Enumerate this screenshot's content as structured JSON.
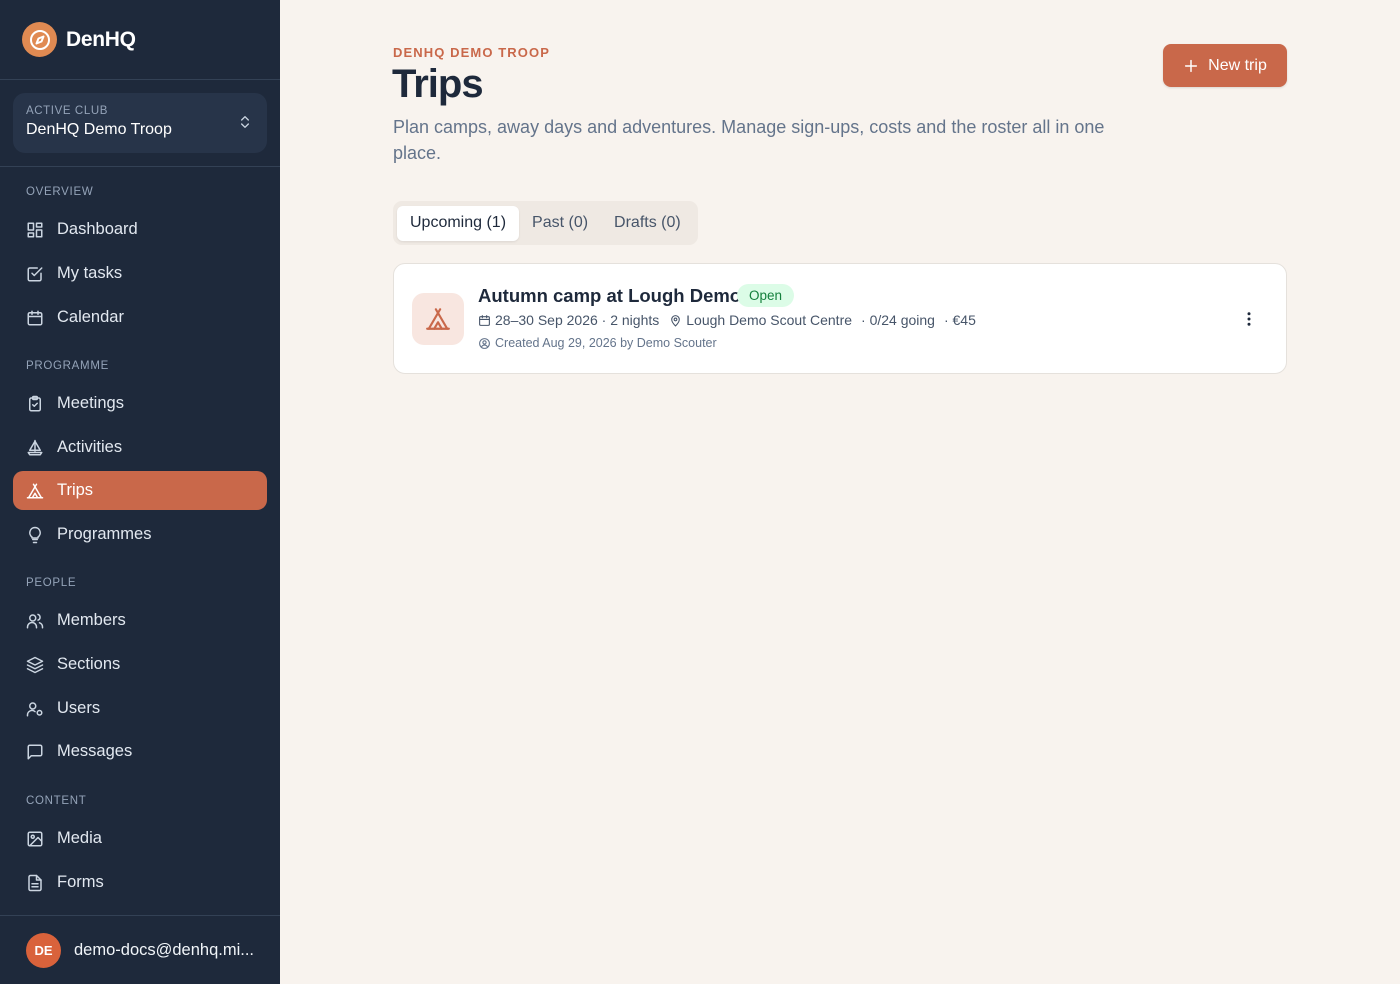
{
  "brand": {
    "name": "DenHQ",
    "accent": "#e08a52"
  },
  "club": {
    "label": "ACTIVE CLUB",
    "name": "DenHQ Demo Troop"
  },
  "nav": {
    "sections": [
      "OVERVIEW",
      "PROGRAMME",
      "PEOPLE",
      "CONTENT"
    ],
    "items": [
      {
        "label": "Dashboard",
        "icon": "dashboard-icon"
      },
      {
        "label": "My tasks",
        "icon": "checkbox-icon"
      },
      {
        "label": "Calendar",
        "icon": "calendar-icon"
      },
      {
        "label": "Meetings",
        "icon": "clipboard-check-icon"
      },
      {
        "label": "Activities",
        "icon": "sailboat-icon"
      },
      {
        "label": "Trips",
        "icon": "tent-icon",
        "active": true
      },
      {
        "label": "Programmes",
        "icon": "lightbulb-icon"
      },
      {
        "label": "Members",
        "icon": "users-icon"
      },
      {
        "label": "Sections",
        "icon": "layers-icon"
      },
      {
        "label": "Users",
        "icon": "user-cog-icon"
      },
      {
        "label": "Messages",
        "icon": "message-icon"
      },
      {
        "label": "Media",
        "icon": "image-icon"
      },
      {
        "label": "Forms",
        "icon": "file-text-icon"
      }
    ]
  },
  "user": {
    "initials": "DE",
    "email": "demo-docs@denhq.mi..."
  },
  "header": {
    "eyebrow": "DENHQ DEMO TROOP",
    "title": "Trips",
    "description": "Plan camps, away days and adventures. Manage sign-ups, costs and the roster all in one place.",
    "new_button": "New trip"
  },
  "tabs": [
    {
      "label": "Upcoming (1)",
      "active": true
    },
    {
      "label": "Past (0)"
    },
    {
      "label": "Drafts (0)"
    }
  ],
  "trips": [
    {
      "title": "Autumn camp at Lough Demo",
      "status": "Open",
      "dates": "28–30 Sep 2026 · 2 nights",
      "location": "Lough Demo Scout Centre",
      "going": "· 0/24 going",
      "cost": "· €45",
      "created": "Created Aug 29, 2026 by Demo Scouter"
    }
  ],
  "colors": {
    "sidebar": "#1e293b",
    "primary": "#c9684a",
    "background": "#f8f3ee",
    "open_badge": "#dcfce7"
  }
}
